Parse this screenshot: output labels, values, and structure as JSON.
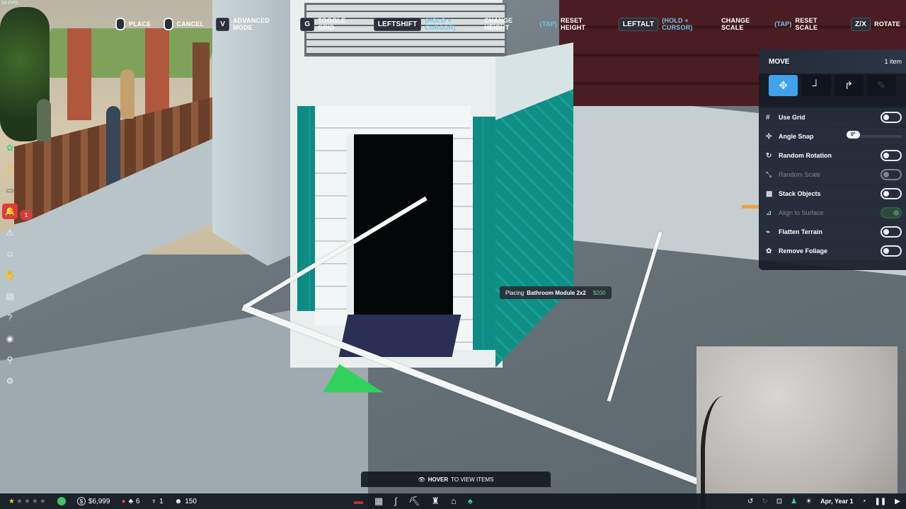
{
  "fps": "34 FPS",
  "hints": [
    {
      "key": "",
      "mouse": "left",
      "label": "PLACE"
    },
    {
      "key": "",
      "mouse": "right",
      "label": "CANCEL"
    },
    {
      "key": "V",
      "label": "ADVANCED MODE"
    },
    {
      "key": "G",
      "label": "TOGGLE GRID"
    },
    {
      "key": "LEFTSHIFT",
      "pre": "(HOLD + CURSOR)",
      "label1": "CHANGE HEIGHT",
      "mid": "(TAP)",
      "label2": "RESET HEIGHT"
    },
    {
      "key": "LEFTALT",
      "pre": "(HOLD + CURSOR)",
      "label1": "CHANGE SCALE",
      "mid": "(TAP)",
      "label2": "RESET SCALE"
    },
    {
      "key": "Z/X",
      "label": "ROTATE"
    }
  ],
  "sidebar_badge": "1",
  "panel": {
    "title": "MOVE",
    "count": "1 item",
    "modes": [
      "move-icon",
      "corner-icon",
      "curve-icon",
      "eyedropper-icon"
    ],
    "options": [
      {
        "label": "Use Grid",
        "state": "off",
        "enabled": true
      },
      {
        "label": "Angle Snap",
        "slider_value": "0°",
        "enabled": true
      },
      {
        "label": "Random Rotation",
        "state": "off",
        "enabled": true
      },
      {
        "label": "Random Scale",
        "state": "off",
        "enabled": false
      },
      {
        "label": "Stack Objects",
        "state": "off",
        "enabled": true
      },
      {
        "label": "Align to Surface",
        "state": "on",
        "enabled": false
      },
      {
        "label": "Flatten Terrain",
        "state": "off",
        "enabled": true
      },
      {
        "label": "Remove Foliage",
        "state": "off",
        "enabled": true
      }
    ]
  },
  "tooltip": {
    "prefix": "Placing",
    "item": "Bathroom Module 2x2",
    "price": "$200"
  },
  "hover_bar": {
    "bold": "HOVER",
    "rest": "TO VIEW ITEMS"
  },
  "status": {
    "money": "$6,999",
    "alerts": "6",
    "staff": "1",
    "guests": "150",
    "date": "Apr, Year 1"
  },
  "colors": {
    "accent": "#3ea2ec",
    "money_positive": "#5fd47c",
    "alert": "#e03a3a"
  }
}
